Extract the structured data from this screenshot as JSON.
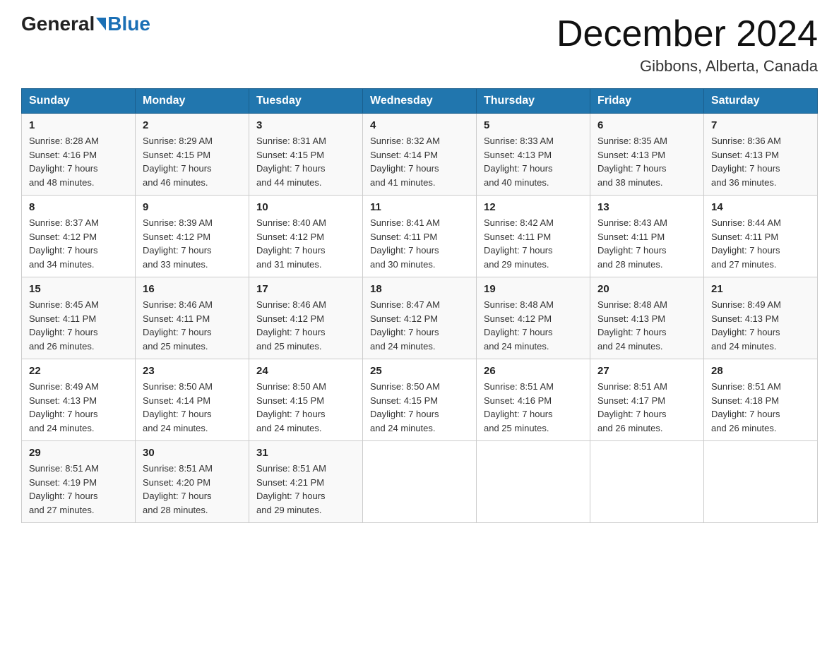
{
  "header": {
    "logo_general": "General",
    "logo_blue": "Blue",
    "month_year": "December 2024",
    "location": "Gibbons, Alberta, Canada"
  },
  "days_of_week": [
    "Sunday",
    "Monday",
    "Tuesday",
    "Wednesday",
    "Thursday",
    "Friday",
    "Saturday"
  ],
  "weeks": [
    [
      {
        "day": "1",
        "sunrise": "8:28 AM",
        "sunset": "4:16 PM",
        "daylight": "7 hours and 48 minutes."
      },
      {
        "day": "2",
        "sunrise": "8:29 AM",
        "sunset": "4:15 PM",
        "daylight": "7 hours and 46 minutes."
      },
      {
        "day": "3",
        "sunrise": "8:31 AM",
        "sunset": "4:15 PM",
        "daylight": "7 hours and 44 minutes."
      },
      {
        "day": "4",
        "sunrise": "8:32 AM",
        "sunset": "4:14 PM",
        "daylight": "7 hours and 41 minutes."
      },
      {
        "day": "5",
        "sunrise": "8:33 AM",
        "sunset": "4:13 PM",
        "daylight": "7 hours and 40 minutes."
      },
      {
        "day": "6",
        "sunrise": "8:35 AM",
        "sunset": "4:13 PM",
        "daylight": "7 hours and 38 minutes."
      },
      {
        "day": "7",
        "sunrise": "8:36 AM",
        "sunset": "4:13 PM",
        "daylight": "7 hours and 36 minutes."
      }
    ],
    [
      {
        "day": "8",
        "sunrise": "8:37 AM",
        "sunset": "4:12 PM",
        "daylight": "7 hours and 34 minutes."
      },
      {
        "day": "9",
        "sunrise": "8:39 AM",
        "sunset": "4:12 PM",
        "daylight": "7 hours and 33 minutes."
      },
      {
        "day": "10",
        "sunrise": "8:40 AM",
        "sunset": "4:12 PM",
        "daylight": "7 hours and 31 minutes."
      },
      {
        "day": "11",
        "sunrise": "8:41 AM",
        "sunset": "4:11 PM",
        "daylight": "7 hours and 30 minutes."
      },
      {
        "day": "12",
        "sunrise": "8:42 AM",
        "sunset": "4:11 PM",
        "daylight": "7 hours and 29 minutes."
      },
      {
        "day": "13",
        "sunrise": "8:43 AM",
        "sunset": "4:11 PM",
        "daylight": "7 hours and 28 minutes."
      },
      {
        "day": "14",
        "sunrise": "8:44 AM",
        "sunset": "4:11 PM",
        "daylight": "7 hours and 27 minutes."
      }
    ],
    [
      {
        "day": "15",
        "sunrise": "8:45 AM",
        "sunset": "4:11 PM",
        "daylight": "7 hours and 26 minutes."
      },
      {
        "day": "16",
        "sunrise": "8:46 AM",
        "sunset": "4:11 PM",
        "daylight": "7 hours and 25 minutes."
      },
      {
        "day": "17",
        "sunrise": "8:46 AM",
        "sunset": "4:12 PM",
        "daylight": "7 hours and 25 minutes."
      },
      {
        "day": "18",
        "sunrise": "8:47 AM",
        "sunset": "4:12 PM",
        "daylight": "7 hours and 24 minutes."
      },
      {
        "day": "19",
        "sunrise": "8:48 AM",
        "sunset": "4:12 PM",
        "daylight": "7 hours and 24 minutes."
      },
      {
        "day": "20",
        "sunrise": "8:48 AM",
        "sunset": "4:13 PM",
        "daylight": "7 hours and 24 minutes."
      },
      {
        "day": "21",
        "sunrise": "8:49 AM",
        "sunset": "4:13 PM",
        "daylight": "7 hours and 24 minutes."
      }
    ],
    [
      {
        "day": "22",
        "sunrise": "8:49 AM",
        "sunset": "4:13 PM",
        "daylight": "7 hours and 24 minutes."
      },
      {
        "day": "23",
        "sunrise": "8:50 AM",
        "sunset": "4:14 PM",
        "daylight": "7 hours and 24 minutes."
      },
      {
        "day": "24",
        "sunrise": "8:50 AM",
        "sunset": "4:15 PM",
        "daylight": "7 hours and 24 minutes."
      },
      {
        "day": "25",
        "sunrise": "8:50 AM",
        "sunset": "4:15 PM",
        "daylight": "7 hours and 24 minutes."
      },
      {
        "day": "26",
        "sunrise": "8:51 AM",
        "sunset": "4:16 PM",
        "daylight": "7 hours and 25 minutes."
      },
      {
        "day": "27",
        "sunrise": "8:51 AM",
        "sunset": "4:17 PM",
        "daylight": "7 hours and 26 minutes."
      },
      {
        "day": "28",
        "sunrise": "8:51 AM",
        "sunset": "4:18 PM",
        "daylight": "7 hours and 26 minutes."
      }
    ],
    [
      {
        "day": "29",
        "sunrise": "8:51 AM",
        "sunset": "4:19 PM",
        "daylight": "7 hours and 27 minutes."
      },
      {
        "day": "30",
        "sunrise": "8:51 AM",
        "sunset": "4:20 PM",
        "daylight": "7 hours and 28 minutes."
      },
      {
        "day": "31",
        "sunrise": "8:51 AM",
        "sunset": "4:21 PM",
        "daylight": "7 hours and 29 minutes."
      },
      null,
      null,
      null,
      null
    ]
  ],
  "labels": {
    "sunrise": "Sunrise:",
    "sunset": "Sunset:",
    "daylight": "Daylight:"
  }
}
